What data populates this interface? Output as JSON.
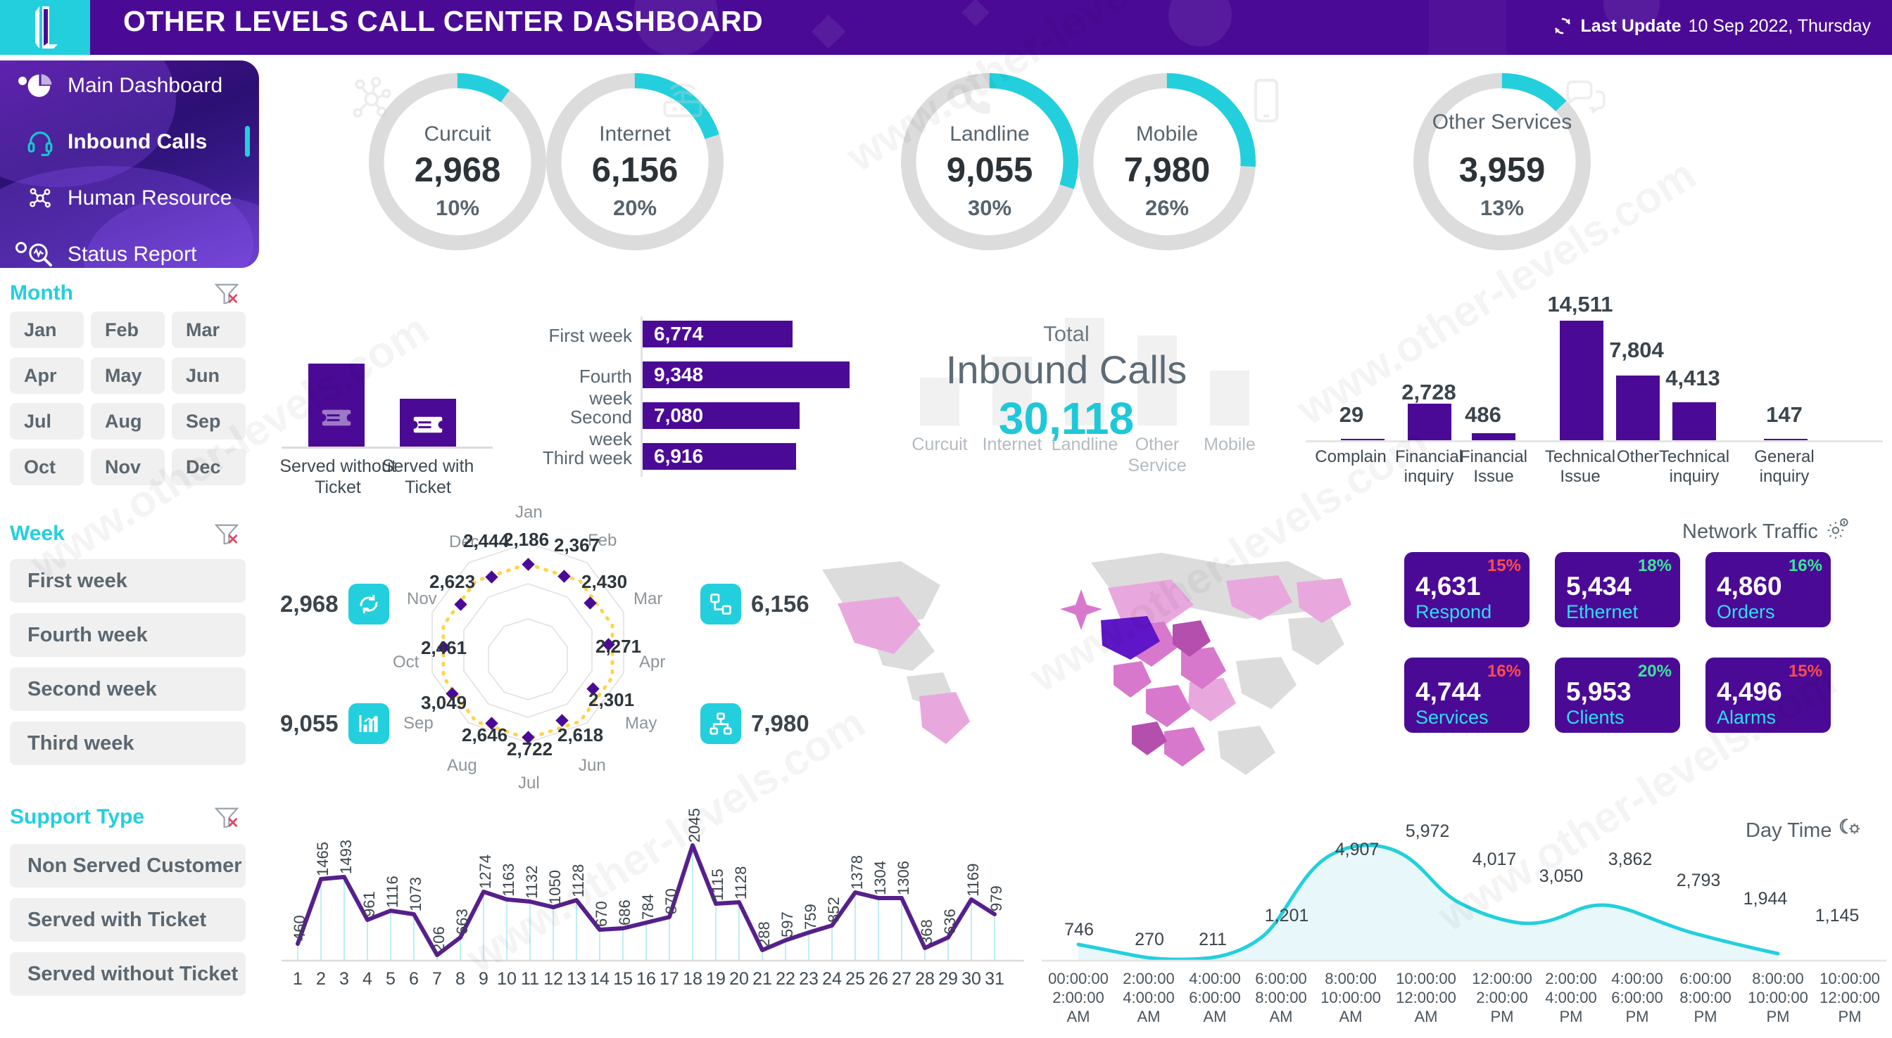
{
  "header": {
    "title": "OTHER LEVELS CALL CENTER DASHBOARD",
    "logo_icon": "other-levels-logo",
    "refresh_icon": "refresh-icon",
    "last_update_label": "Last Update",
    "last_update_value": "10 Sep 2022, Thursday",
    "bg_color": "#4b0a96",
    "accent_color": "#23cfdd"
  },
  "sidebar": {
    "items": [
      {
        "label": "Main Dashboard",
        "icon": "pie-chart-icon",
        "active": false
      },
      {
        "label": "Inbound Calls",
        "icon": "headset-icon",
        "active": true
      },
      {
        "label": "Human Resource",
        "icon": "network-nodes-icon",
        "active": false
      },
      {
        "label": "Status Report",
        "icon": "search-pulse-icon",
        "active": false
      }
    ]
  },
  "filters": {
    "month": {
      "title": "Month",
      "clear_icon": "clear-filter-icon",
      "options": [
        "Jan",
        "Feb",
        "Mar",
        "Apr",
        "May",
        "Jun",
        "Jul",
        "Aug",
        "Sep",
        "Oct",
        "Nov",
        "Dec"
      ]
    },
    "week": {
      "title": "Week",
      "clear_icon": "clear-filter-icon",
      "options": [
        "First week",
        "Fourth week",
        "Second week",
        "Third week"
      ]
    },
    "support_type": {
      "title": "Support Type",
      "clear_icon": "clear-filter-icon",
      "options": [
        "Non Served Customer",
        "Served with Ticket",
        "Served without Ticket"
      ]
    }
  },
  "gauges": [
    {
      "label": "Curcuit",
      "value": "2,968",
      "percent": "10%",
      "pct_num": 10,
      "icon": "molecule-icon"
    },
    {
      "label": "Internet",
      "value": "6,156",
      "percent": "20%",
      "pct_num": 20,
      "icon": "router-icon"
    },
    {
      "label": "Landline",
      "value": "9,055",
      "percent": "30%",
      "pct_num": 30,
      "icon": "phone-icon"
    },
    {
      "label": "Mobile",
      "value": "7,980",
      "percent": "26%",
      "pct_num": 26,
      "icon": "smartphone-icon"
    },
    {
      "label": "Other Services",
      "value": "3,959",
      "percent": "13%",
      "pct_num": 13,
      "icon": "chat-bubbles-icon"
    }
  ],
  "served_chart": {
    "type": "bar",
    "categories": [
      "Served without Ticket",
      "Served with Ticket"
    ],
    "values": [
      100,
      76
    ],
    "icon": "ticket-icon",
    "color": "#4b0a96"
  },
  "week_chart": {
    "type": "bar",
    "orientation": "horizontal",
    "categories": [
      "First week",
      "Fourth week",
      "Second week",
      "Third week"
    ],
    "values": [
      6774,
      9348,
      7080,
      6916
    ],
    "labels": [
      "6,774",
      "9,348",
      "7,080",
      "6,916"
    ],
    "color": "#4b0a96"
  },
  "total_panel": {
    "small_label": "Total",
    "big_label": "Inbound Calls",
    "value": "30,118",
    "categories": [
      "Curcuit",
      "Internet",
      "Landline",
      "Other Service",
      "Mobile"
    ],
    "bar_heights": [
      58,
      98,
      128,
      112,
      72
    ],
    "accent": "#1ec8d8"
  },
  "complaint_chart": {
    "type": "bar",
    "categories": [
      "Complain",
      "Financial inquiry",
      "Financial Issue",
      "Technical Issue",
      "Other",
      "Technical inquiry",
      "General inquiry"
    ],
    "values": [
      29,
      2728,
      486,
      14511,
      7804,
      4413,
      147
    ],
    "labels": [
      "29",
      "2,728",
      "486",
      "14,511",
      "7,804",
      "4,413",
      "147"
    ],
    "color": "#4b0a96",
    "ylim": [
      0,
      14511
    ]
  },
  "radar_chart": {
    "type": "line",
    "categories": [
      "Jan",
      "Feb",
      "Mar",
      "Apr",
      "May",
      "Jun",
      "Jul",
      "Aug",
      "Sep",
      "Oct",
      "Nov",
      "Dec"
    ],
    "values": [
      2186,
      2367,
      2430,
      2271,
      2301,
      2618,
      2722,
      2646,
      3049,
      2461,
      2623,
      2444
    ],
    "labels": [
      "2,186",
      "2,367",
      "2,430",
      "2,271",
      "2,301",
      "2,618",
      "2,722",
      "2,646",
      "3,049",
      "2,461",
      "2,623",
      "2,444"
    ],
    "marker_color": "#4b0a96",
    "line_color": "#ffd44d",
    "side_kpis": [
      {
        "value": "2,968",
        "icon": "refresh-cycle-icon",
        "side": "left-top"
      },
      {
        "value": "9,055",
        "icon": "bar-growth-icon",
        "side": "left-bottom"
      },
      {
        "value": "6,156",
        "icon": "server-node-icon",
        "side": "right-top"
      },
      {
        "value": "7,980",
        "icon": "network-share-icon",
        "side": "right-bottom"
      }
    ]
  },
  "network_traffic": {
    "title": "Network Traffic",
    "icon": "gear-info-icon",
    "cards": [
      {
        "value": "4,631",
        "name": "Respond",
        "percent": "15%",
        "trend_color": "#ff4d4d"
      },
      {
        "value": "5,434",
        "name": "Ethernet",
        "percent": "18%",
        "trend_color": "#3ce698"
      },
      {
        "value": "4,860",
        "name": "Orders",
        "percent": "16%",
        "trend_color": "#3ce698"
      },
      {
        "value": "4,744",
        "name": "Services",
        "percent": "16%",
        "trend_color": "#ff4d4d"
      },
      {
        "value": "5,953",
        "name": "Clients",
        "percent": "20%",
        "trend_color": "#3ce698"
      },
      {
        "value": "4,496",
        "name": "Alarms",
        "percent": "15%",
        "trend_color": "#ff4d4d"
      }
    ]
  },
  "daily_chart": {
    "type": "line",
    "xlabel": "",
    "categories": [
      "1",
      "2",
      "3",
      "4",
      "5",
      "6",
      "7",
      "8",
      "9",
      "10",
      "11",
      "12",
      "13",
      "14",
      "15",
      "16",
      "17",
      "18",
      "19",
      "20",
      "21",
      "22",
      "23",
      "24",
      "25",
      "26",
      "27",
      "28",
      "29",
      "30",
      "31"
    ],
    "values": [
      460,
      1465,
      1493,
      961,
      1116,
      1073,
      206,
      663,
      1274,
      1163,
      1132,
      1050,
      1128,
      670,
      686,
      784,
      870,
      2045,
      1115,
      1128,
      288,
      597,
      759,
      852,
      1378,
      1304,
      1306,
      368,
      636,
      1169,
      979
    ],
    "labels": [
      "460",
      "1465",
      "1493",
      "961",
      "1116",
      "1073",
      "206",
      "663",
      "1274",
      "1163",
      "1132",
      "1050",
      "1128",
      "670",
      "686",
      "784",
      "870",
      "2045",
      "1115",
      "1128",
      "288",
      "597",
      "759",
      "852",
      "1378",
      "1304",
      "1306",
      "368",
      "636",
      "1169",
      "979"
    ],
    "color": "#56208c"
  },
  "daytime_chart": {
    "type": "area",
    "title": "Day Time",
    "icon": "day-night-icon",
    "categories": [
      "00:00:00\n2:00:00\nAM",
      "2:00:00\n4:00:00\nAM",
      "4:00:00\n6:00:00\nAM",
      "6:00:00\n8:00:00\nAM",
      "8:00:00\n10:00:00\nAM",
      "10:00:00\n12:00:00\nAM",
      "12:00:00\n2:00:00\nPM",
      "2:00:00\n4:00:00\nPM",
      "4:00:00\n6:00:00\nPM",
      "6:00:00\n8:00:00\nPM",
      "8:00:00\n10:00:00\nPM",
      "10:00:00\n12:00:00\nPM"
    ],
    "tick_lines": [
      [
        "00:00:00",
        "2:00:00",
        "AM"
      ],
      [
        "2:00:00",
        "4:00:00",
        "AM"
      ],
      [
        "4:00:00",
        "6:00:00",
        "AM"
      ],
      [
        "6:00:00",
        "8:00:00",
        "AM"
      ],
      [
        "8:00:00",
        "10:00:00",
        "AM"
      ],
      [
        "10:00:00",
        "12:00:00",
        "AM"
      ],
      [
        "12:00:00",
        "2:00:00",
        "PM"
      ],
      [
        "2:00:00",
        "4:00:00",
        "PM"
      ],
      [
        "4:00:00",
        "6:00:00",
        "PM"
      ],
      [
        "6:00:00",
        "8:00:00",
        "PM"
      ],
      [
        "8:00:00",
        "10:00:00",
        "PM"
      ],
      [
        "10:00:00",
        "12:00:00",
        "PM"
      ]
    ],
    "values": [
      746,
      270,
      211,
      1201,
      4907,
      5972,
      4017,
      3050,
      3862,
      2793,
      1944,
      1145
    ],
    "labels": [
      "746",
      "270",
      "211",
      "1,201",
      "4,907",
      "5,972",
      "4,017",
      "3,050",
      "3,862",
      "2,793",
      "1,944",
      "1,145"
    ],
    "color": "#23cfdd",
    "fill": "#e8f8fa"
  },
  "watermarks": [
    "www.other-levels.com"
  ]
}
